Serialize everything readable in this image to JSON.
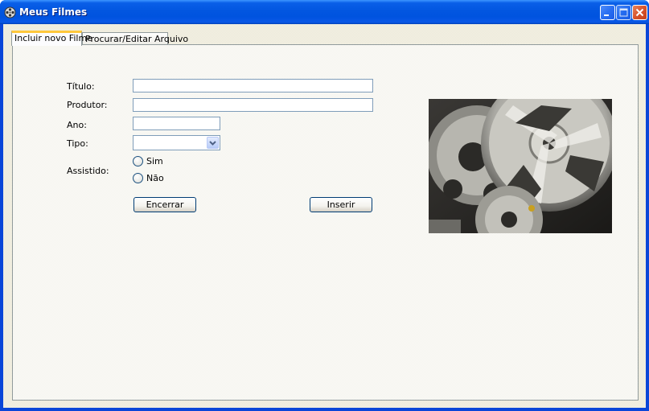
{
  "window": {
    "title": "Meus Filmes"
  },
  "tabs": [
    {
      "label": "Incluir novo Filme",
      "active": true
    },
    {
      "label": "Procurar/Editar Arquivo",
      "active": false
    }
  ],
  "form": {
    "titulo_label": "Título:",
    "titulo_value": "",
    "produtor_label": "Produtor:",
    "produtor_value": "",
    "ano_label": "Ano:",
    "ano_value": "",
    "tipo_label": "Tipo:",
    "tipo_value": "",
    "assistido_label": "Assistido:",
    "assistido_options": [
      {
        "label": "Sim",
        "checked": false
      },
      {
        "label": "Não",
        "checked": false
      }
    ]
  },
  "buttons": {
    "encerrar": "Encerrar",
    "inserir": "Inserir"
  },
  "icons": {
    "app": "film-reel-icon",
    "minimize": "minimize-icon",
    "maximize": "maximize-icon",
    "close": "close-icon",
    "dropdown": "chevron-down-icon"
  },
  "colors": {
    "titlebar": "#0053df",
    "close_button": "#d8532c",
    "active_tab_accent": "#ffc83c",
    "input_border": "#7f9db9"
  }
}
